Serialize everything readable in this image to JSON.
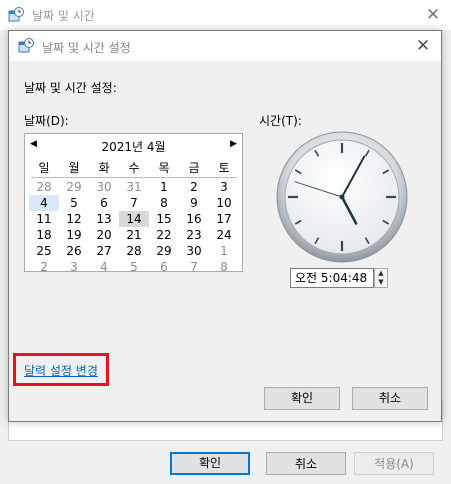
{
  "outer_window": {
    "title": "날짜 및 시간",
    "close_symbol": "✕",
    "buttons": {
      "ok": "확인",
      "cancel": "취소",
      "apply": "적용(A)"
    }
  },
  "dialog": {
    "title": "날짜 및 시간 설정",
    "close_symbol": "✕",
    "heading": "날짜 및 시간 설정:",
    "date_label": "날짜(D):",
    "time_label": "시간(T):",
    "link": "달력 설정 변경",
    "buttons": {
      "ok": "확인",
      "cancel": "취소"
    }
  },
  "calendar": {
    "month_title": "2021년 4월",
    "prev_symbol": "◀",
    "next_symbol": "▶",
    "weekdays": [
      "일",
      "월",
      "화",
      "수",
      "목",
      "금",
      "토"
    ],
    "weeks": [
      [
        "28",
        "29",
        "30",
        "31",
        "1",
        "2",
        "3"
      ],
      [
        "4",
        "5",
        "6",
        "7",
        "8",
        "9",
        "10"
      ],
      [
        "11",
        "12",
        "13",
        "14",
        "15",
        "16",
        "17"
      ],
      [
        "18",
        "19",
        "20",
        "21",
        "22",
        "23",
        "24"
      ],
      [
        "25",
        "26",
        "27",
        "28",
        "29",
        "30",
        "1"
      ],
      [
        "2",
        "3",
        "4",
        "5",
        "6",
        "7",
        "8"
      ]
    ],
    "selected_day": "4",
    "today": "14"
  },
  "time": {
    "value": "오전   5:04:48",
    "up_symbol": "▲",
    "down_symbol": "▼",
    "hours": 5,
    "minutes": 4,
    "seconds": 48
  }
}
